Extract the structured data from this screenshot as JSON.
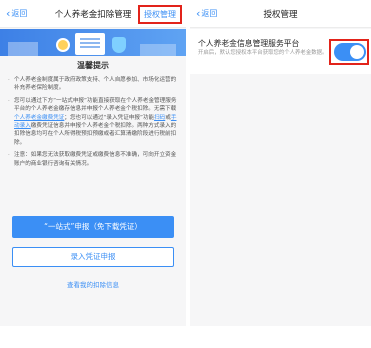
{
  "left_screen": {
    "nav": {
      "back_label": "返回",
      "title": "个人养老金扣除管理",
      "right_action": "授权管理"
    },
    "tips": {
      "title": "温馨提示",
      "items": [
        {
          "text": "个人养老金制度属于政府政策支持、个人自愿参加、市场化运营的补充养老保险制度。"
        },
        {
          "text_1": "您可以通过下方“一站式申报”功能直接获取在个人养老金管理服务平台的个人养老金缴存信息并申报个人养老金个税扣除。无需下载",
          "link_1": "个人养老金缴费凭证",
          "text_2": "；您也可以通过“录入凭证申报”功能",
          "link_2": "扫码",
          "text_3": "或",
          "link_3": "手动录入",
          "text_4": "缴费凭证信息并申报个人养老金个税扣除。两种方式录入的扣除信息均可在个人所得税预扣预缴或者汇算清缴阶段进行税前扣除。"
        },
        {
          "text": "注意：如果您无法获取缴费凭证或缴费信息不准确，可向开立资金账户的商业银行咨询有关情况。"
        }
      ]
    },
    "primary_button": "“一站式”申报（免下载凭证）",
    "secondary_button": "录入凭证申报",
    "bottom_link": "查看我的扣除信息"
  },
  "right_screen": {
    "nav": {
      "back_label": "返回",
      "title": "授权管理"
    },
    "setting": {
      "title": "个人养老金信息管理服务平台",
      "description": "开启后，默认您授权本平台获取您的个人养老金数据。",
      "toggle_state": "on"
    }
  },
  "colors": {
    "accent": "#3b8ff5",
    "highlight_border": "#e2231a"
  }
}
